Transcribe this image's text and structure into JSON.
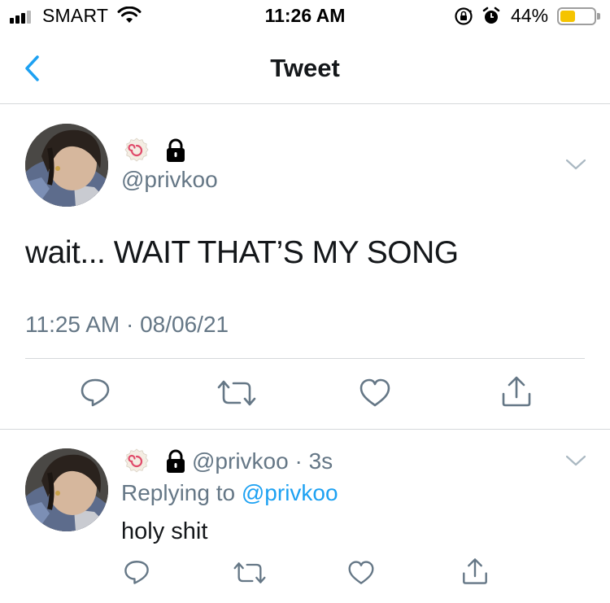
{
  "status_bar": {
    "carrier": "SMART",
    "time": "11:26 AM",
    "battery_percent": "44%",
    "battery_level": 0.44,
    "battery_color": "#f5c400"
  },
  "nav": {
    "back_icon": "chevron-left-icon",
    "title": "Tweet",
    "accent_color": "#1da1f2"
  },
  "main_tweet": {
    "handle": "@privkoo",
    "text": "wait... WAIT THAT’S MY SONG",
    "timestamp": "11:25 AM · 08/06/21",
    "badges": [
      "fish-cake-emoji",
      "lock-icon"
    ],
    "actions": [
      "reply-icon",
      "retweet-icon",
      "like-icon",
      "share-icon"
    ]
  },
  "reply": {
    "handle_time": "@privkoo · 3s",
    "replying_prefix": "Replying to ",
    "replying_to": "@privkoo",
    "text": "holy shit",
    "actions": [
      "reply-icon",
      "retweet-icon",
      "like-icon",
      "share-icon"
    ]
  }
}
